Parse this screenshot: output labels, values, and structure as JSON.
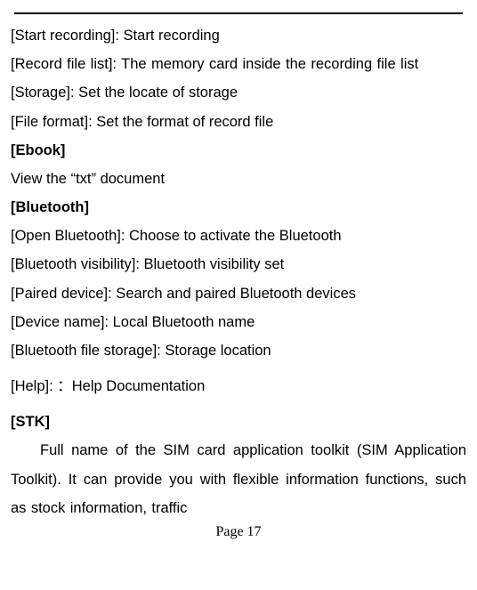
{
  "lines": {
    "l1": "[Start recording]: Start recording",
    "l2": "[Record file list]: The memory card inside the recording file list",
    "l3": "[Storage]: Set the locate of storage",
    "l4": "[File format]: Set the format of record file",
    "s_ebook": "[Ebook]",
    "l5": "View the “txt” document",
    "s_bluetooth": "[Bluetooth]",
    "l6": "[Open Bluetooth]: Choose to activate the Bluetooth",
    "l7": "[Bluetooth visibility]: Bluetooth visibility set",
    "l8": "[Paired device]: Search and paired Bluetooth devices",
    "l9": "[Device name]: Local Bluetooth name",
    "l10": "[Bluetooth file storage]: Storage location",
    "l11": "[Help]: ：Help Documentation",
    "s_stk": "[STK]",
    "p1a": "Full name of the SIM card application toolkit (SIM Application Toolkit). It can provide you with flexible information functions, such as stock information, traffic"
  },
  "page_number": "Page 17"
}
